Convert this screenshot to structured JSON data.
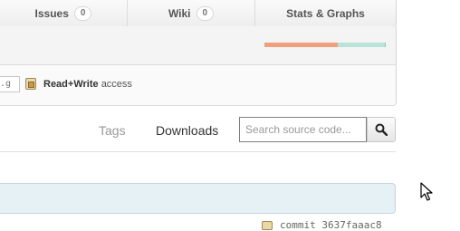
{
  "tabs": [
    {
      "label": "Issues",
      "count": "0"
    },
    {
      "label": "Wiki",
      "count": "0"
    },
    {
      "label": "Stats & Graphs"
    }
  ],
  "language_bar": {
    "colors": [
      "#eea17c",
      "#b9e3d6",
      "#94c5b5"
    ]
  },
  "clone": {
    "url_value": ".g",
    "access_strong": "Read+Write",
    "access_rest": "access"
  },
  "subnav": {
    "tags_label": "Tags",
    "downloads_label": "Downloads"
  },
  "search": {
    "placeholder": "Search source code..."
  },
  "commit": {
    "text": "commit 3637faaac8"
  },
  "icons": {
    "search_button": "search-icon",
    "access": "clipboard-icon",
    "cursor": "mouse-pointer-icon"
  }
}
